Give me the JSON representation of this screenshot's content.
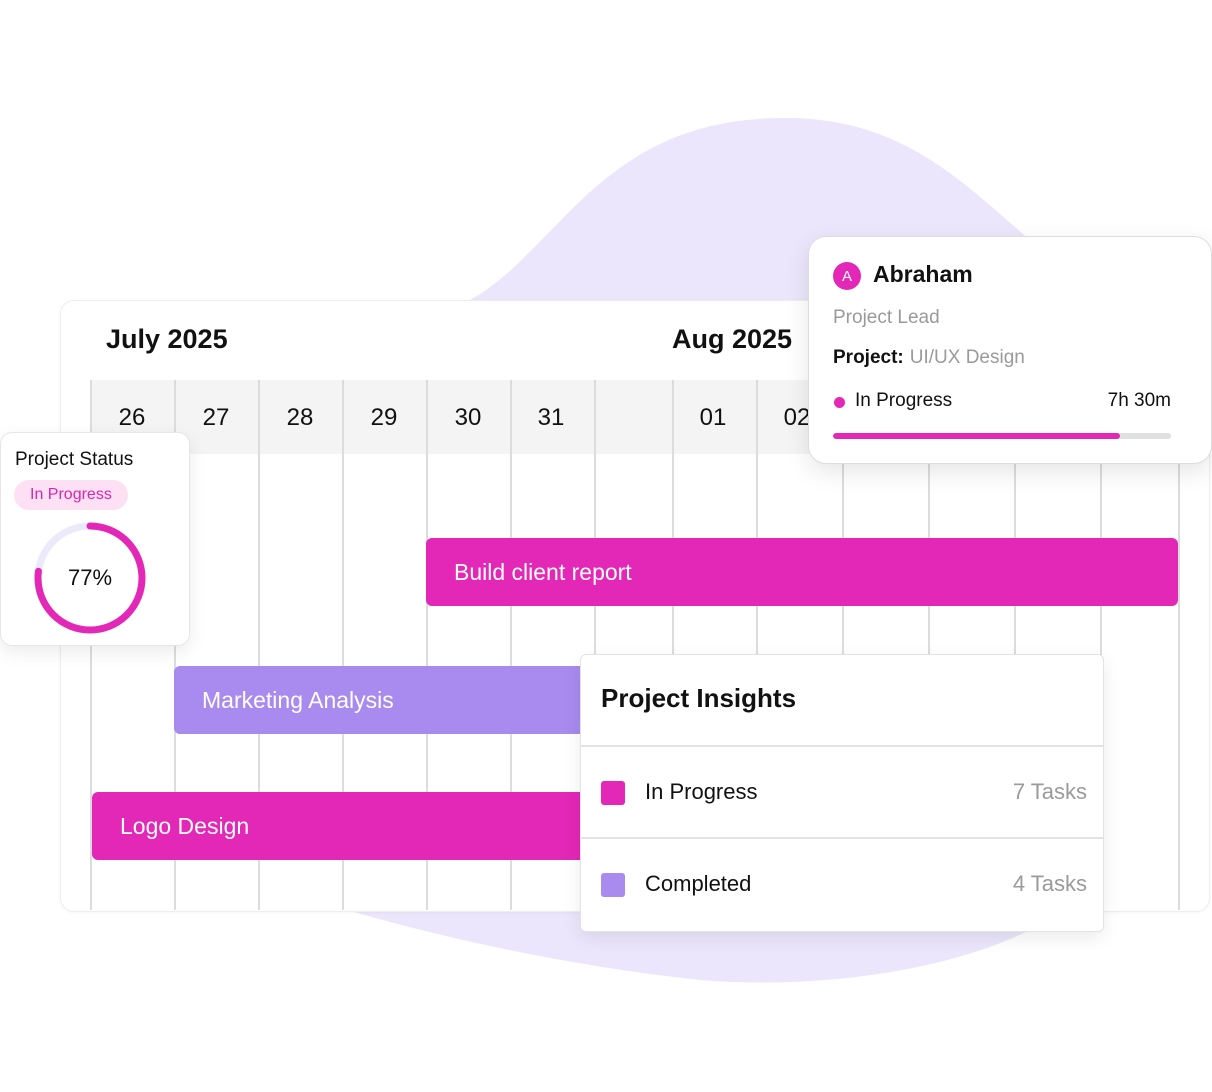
{
  "colors": {
    "accent_pink": "#e327b7",
    "accent_purple": "#a98aee",
    "blob": "#ebe6fb"
  },
  "gantt": {
    "months": [
      "July 2025",
      "Aug 2025"
    ],
    "dates": [
      "26",
      "27",
      "28",
      "29",
      "30",
      "31",
      "01",
      "02"
    ],
    "tasks": [
      {
        "label": "Build client report",
        "color": "pink"
      },
      {
        "label": "Marketing Analysis",
        "color": "purple"
      },
      {
        "label": "Logo Design",
        "color": "pink"
      }
    ]
  },
  "status_card": {
    "title": "Project Status",
    "badge": "In Progress",
    "percent": 77,
    "percent_label": "77%"
  },
  "person_card": {
    "avatar_initial": "A",
    "name": "Abraham",
    "role": "Project Lead",
    "project_key": "Project:",
    "project_value": "UI/UX Design",
    "status_label": "In Progress",
    "time": "7h 30m",
    "progress": 0.85
  },
  "insights": {
    "title": "Project Insights",
    "rows": [
      {
        "label": "In Progress",
        "count": "7 Tasks"
      },
      {
        "label": "Completed",
        "count": "4 Tasks"
      }
    ]
  }
}
